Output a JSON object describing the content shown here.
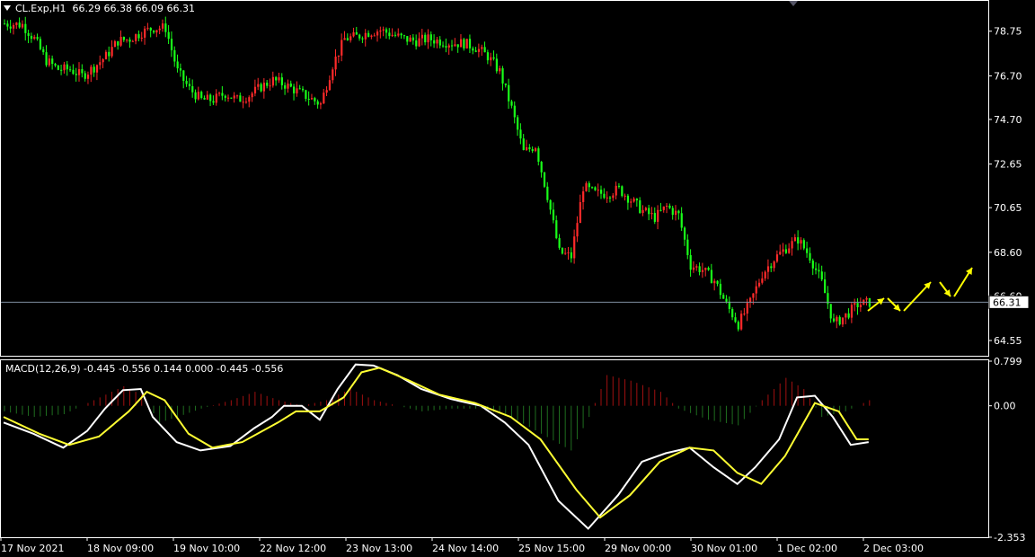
{
  "header": {
    "symbol": "CL.Exp,H1",
    "ohlc": "66.29 66.38 66.09 66.31"
  },
  "macd_header": {
    "label": "MACD(12,26,9) -0.445 -0.556 0.144 0.000 -0.445 -0.556"
  },
  "colors": {
    "background": "#000000",
    "bull_candle": "#ff2a2a",
    "bear_candle": "#19ff19",
    "macd_line": "#ffffff",
    "signal_line": "#ffff33",
    "hist_positive": "#a01010",
    "hist_negative": "#1f6e1f",
    "forecast_arrow": "#ffff00",
    "axis": "#ffffff",
    "price_line": "#7f8fa0"
  },
  "chart_data": [
    {
      "type": "candlestick",
      "title": "",
      "symbol": "CL.Exp",
      "timeframe": "H1",
      "current_price": 66.31,
      "current_price_label": "66.31",
      "ylim": [
        63.85,
        80.1
      ],
      "y_ticks": [
        "78.75",
        "76.70",
        "74.70",
        "72.65",
        "70.65",
        "68.60",
        "66.60",
        "64.55"
      ],
      "y_tick_values": [
        78.75,
        76.7,
        74.7,
        72.65,
        70.65,
        68.6,
        66.6,
        64.55
      ],
      "x_ticks": [
        "17 Nov 2021",
        "18 Nov 09:00",
        "19 Nov 10:00",
        "22 Nov 12:00",
        "23 Nov 13:00",
        "24 Nov 14:00",
        "25 Nov 15:00",
        "29 Nov 00:00",
        "30 Nov 01:00",
        "1 Dec 02:00",
        "2 Dec 03:00"
      ],
      "close_path": [
        [
          0,
          79.1
        ],
        [
          6,
          79.05
        ],
        [
          10,
          78.4
        ],
        [
          14,
          77.4
        ],
        [
          18,
          77.0
        ],
        [
          22,
          77.0
        ],
        [
          26,
          76.7
        ],
        [
          30,
          77.1
        ],
        [
          34,
          77.6
        ],
        [
          38,
          78.3
        ],
        [
          42,
          78.4
        ],
        [
          46,
          78.7
        ],
        [
          50,
          78.9
        ],
        [
          54,
          78.9
        ],
        [
          58,
          76.9
        ],
        [
          62,
          76.1
        ],
        [
          66,
          75.6
        ],
        [
          70,
          75.6
        ],
        [
          74,
          75.9
        ],
        [
          78,
          75.6
        ],
        [
          82,
          75.8
        ],
        [
          86,
          76.2
        ],
        [
          90,
          76.5
        ],
        [
          94,
          76.3
        ],
        [
          98,
          76.0
        ],
        [
          102,
          75.7
        ],
        [
          106,
          75.4
        ],
        [
          110,
          77.2
        ],
        [
          114,
          78.4
        ],
        [
          118,
          78.5
        ],
        [
          122,
          78.7
        ],
        [
          126,
          78.8
        ],
        [
          130,
          78.6
        ],
        [
          134,
          78.4
        ],
        [
          138,
          78.3
        ],
        [
          142,
          78.4
        ],
        [
          146,
          78.3
        ],
        [
          150,
          78.2
        ],
        [
          154,
          78.2
        ],
        [
          158,
          78.0
        ],
        [
          162,
          77.6
        ],
        [
          166,
          76.9
        ],
        [
          170,
          75.2
        ],
        [
          174,
          73.2
        ],
        [
          178,
          73.5
        ],
        [
          182,
          71.2
        ],
        [
          186,
          68.6
        ],
        [
          190,
          68.4
        ],
        [
          194,
          71.6
        ],
        [
          198,
          71.3
        ],
        [
          202,
          71.3
        ],
        [
          206,
          71.5
        ],
        [
          210,
          71.0
        ],
        [
          214,
          70.5
        ],
        [
          218,
          70.2
        ],
        [
          222,
          70.7
        ],
        [
          226,
          70.3
        ],
        [
          230,
          68.0
        ],
        [
          234,
          67.8
        ],
        [
          238,
          67.3
        ],
        [
          242,
          66.2
        ],
        [
          246,
          65.3
        ],
        [
          250,
          66.3
        ],
        [
          254,
          67.6
        ],
        [
          258,
          68.3
        ],
        [
          262,
          68.8
        ],
        [
          266,
          69.2
        ],
        [
          270,
          68.4
        ],
        [
          274,
          67.2
        ],
        [
          278,
          65.3
        ],
        [
          282,
          65.7
        ],
        [
          286,
          66.2
        ],
        [
          290,
          66.3
        ]
      ],
      "n_candles": 291
    },
    {
      "type": "line",
      "title": "MACD(12,26,9)",
      "ylim": [
        -2.353,
        0.799
      ],
      "y_ticks": [
        "0.799",
        "0.00",
        "-2.353"
      ],
      "series": [
        {
          "name": "MACD",
          "points": [
            [
              0,
              -0.3
            ],
            [
              10,
              -0.5
            ],
            [
              20,
              -0.75
            ],
            [
              28,
              -0.45
            ],
            [
              34,
              -0.05
            ],
            [
              40,
              0.28
            ],
            [
              46,
              0.3
            ],
            [
              50,
              -0.2
            ],
            [
              58,
              -0.65
            ],
            [
              66,
              -0.8
            ],
            [
              76,
              -0.72
            ],
            [
              84,
              -0.4
            ],
            [
              90,
              -0.2
            ],
            [
              94,
              0.0
            ],
            [
              100,
              0.0
            ],
            [
              106,
              -0.25
            ],
            [
              112,
              0.3
            ],
            [
              118,
              0.74
            ],
            [
              124,
              0.72
            ],
            [
              132,
              0.55
            ],
            [
              140,
              0.3
            ],
            [
              150,
              0.12
            ],
            [
              160,
              0.0
            ],
            [
              168,
              -0.3
            ],
            [
              176,
              -0.7
            ],
            [
              186,
              -1.7
            ],
            [
              196,
              -2.2
            ],
            [
              206,
              -1.6
            ],
            [
              214,
              -1.0
            ],
            [
              222,
              -0.85
            ],
            [
              230,
              -0.75
            ],
            [
              238,
              -1.1
            ],
            [
              246,
              -1.4
            ],
            [
              252,
              -1.1
            ],
            [
              260,
              -0.6
            ],
            [
              266,
              0.15
            ],
            [
              272,
              0.18
            ],
            [
              278,
              -0.2
            ],
            [
              284,
              -0.7
            ],
            [
              290,
              -0.65
            ]
          ]
        },
        {
          "name": "Signal",
          "points": [
            [
              0,
              -0.2
            ],
            [
              12,
              -0.5
            ],
            [
              22,
              -0.7
            ],
            [
              32,
              -0.55
            ],
            [
              42,
              -0.1
            ],
            [
              48,
              0.25
            ],
            [
              54,
              0.1
            ],
            [
              62,
              -0.5
            ],
            [
              70,
              -0.75
            ],
            [
              80,
              -0.65
            ],
            [
              92,
              -0.3
            ],
            [
              98,
              -0.1
            ],
            [
              106,
              -0.1
            ],
            [
              114,
              0.15
            ],
            [
              120,
              0.6
            ],
            [
              126,
              0.68
            ],
            [
              136,
              0.45
            ],
            [
              146,
              0.2
            ],
            [
              158,
              0.05
            ],
            [
              170,
              -0.2
            ],
            [
              180,
              -0.6
            ],
            [
              192,
              -1.5
            ],
            [
              200,
              -2.0
            ],
            [
              210,
              -1.6
            ],
            [
              220,
              -1.0
            ],
            [
              230,
              -0.75
            ],
            [
              238,
              -0.8
            ],
            [
              246,
              -1.2
            ],
            [
              254,
              -1.4
            ],
            [
              262,
              -0.9
            ],
            [
              272,
              0.05
            ],
            [
              280,
              -0.1
            ],
            [
              286,
              -0.6
            ],
            [
              290,
              -0.6
            ]
          ]
        }
      ],
      "histogram": [
        [
          0,
          -0.1
        ],
        [
          10,
          -0.2
        ],
        [
          20,
          -0.15
        ],
        [
          30,
          0.1
        ],
        [
          40,
          0.35
        ],
        [
          46,
          0.2
        ],
        [
          52,
          -0.3
        ],
        [
          58,
          -0.2
        ],
        [
          66,
          -0.05
        ],
        [
          76,
          0.1
        ],
        [
          84,
          0.25
        ],
        [
          92,
          0.1
        ],
        [
          100,
          0.0
        ],
        [
          108,
          0.1
        ],
        [
          116,
          0.3
        ],
        [
          124,
          0.1
        ],
        [
          132,
          0.0
        ],
        [
          140,
          -0.1
        ],
        [
          150,
          -0.05
        ],
        [
          160,
          -0.05
        ],
        [
          170,
          -0.2
        ],
        [
          180,
          -0.5
        ],
        [
          190,
          -0.8
        ],
        [
          196,
          -0.2
        ],
        [
          202,
          0.55
        ],
        [
          210,
          0.45
        ],
        [
          220,
          0.25
        ],
        [
          226,
          -0.05
        ],
        [
          236,
          -0.25
        ],
        [
          246,
          -0.35
        ],
        [
          254,
          0.1
        ],
        [
          262,
          0.5
        ],
        [
          268,
          0.3
        ],
        [
          274,
          -0.2
        ],
        [
          282,
          -0.1
        ],
        [
          290,
          0.1
        ]
      ]
    }
  ]
}
